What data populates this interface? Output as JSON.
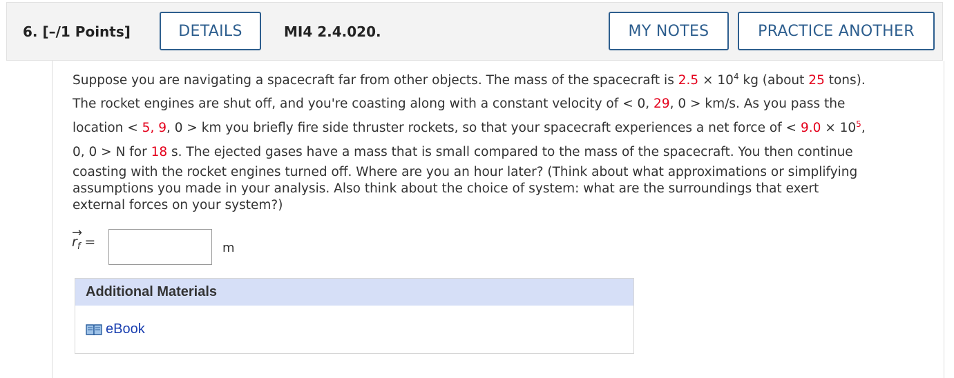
{
  "header": {
    "question_number": "6.  [–/1 Points]",
    "details_label": "DETAILS",
    "question_code": "MI4 2.4.020.",
    "my_notes_label": "MY NOTES",
    "practice_label": "PRACTICE ANOTHER"
  },
  "question": {
    "l1_a": "Suppose you are navigating a spacecraft far from other objects. The mass of the spacecraft is ",
    "mass_coef": "2.5",
    "times1": " × 10",
    "mass_exp": "4",
    "l1_b": " kg (about ",
    "tons": "25",
    "l1_c": " tons).",
    "l2_a": "The rocket engines are shut off, and you're coasting along with a constant velocity of < 0, ",
    "vel_y": "29",
    "l2_b": ", 0 > km/s. As you pass the",
    "l3_a": "location < ",
    "loc_x": "5",
    "sep1": ", ",
    "loc_y": "9",
    "l3_b": ", 0 > km you briefly fire side thruster rockets, so that your spacecraft experiences a net force of < ",
    "force_coef": "9.0",
    "times2": " × 10",
    "force_exp": "5",
    "l3_c": ",",
    "l4_a": "0, 0 > N for ",
    "duration": "18",
    "l4_b": " s. The ejected gases have a mass that is small compared to the mass of the spacecraft. You then continue",
    "l5": "coasting with the rocket engines turned off. Where are you an hour later? (Think about what approximations or simplifying",
    "l6": "assumptions you made in your analysis. Also think about the choice of system: what are the surroundings that exert",
    "l7": "external forces on your system?)"
  },
  "answer": {
    "arrow": "→",
    "variable": "r",
    "subscript": "f",
    "equals": "=",
    "value": "",
    "unit": "m"
  },
  "materials": {
    "heading": "Additional Materials",
    "ebook_label": "eBook",
    "ebook_icon": "book-icon"
  },
  "colors": {
    "accent": "#2d5e8e",
    "highlight": "#e4001b",
    "materials_header_bg": "#d6dff7",
    "link": "#1a3fb0"
  }
}
